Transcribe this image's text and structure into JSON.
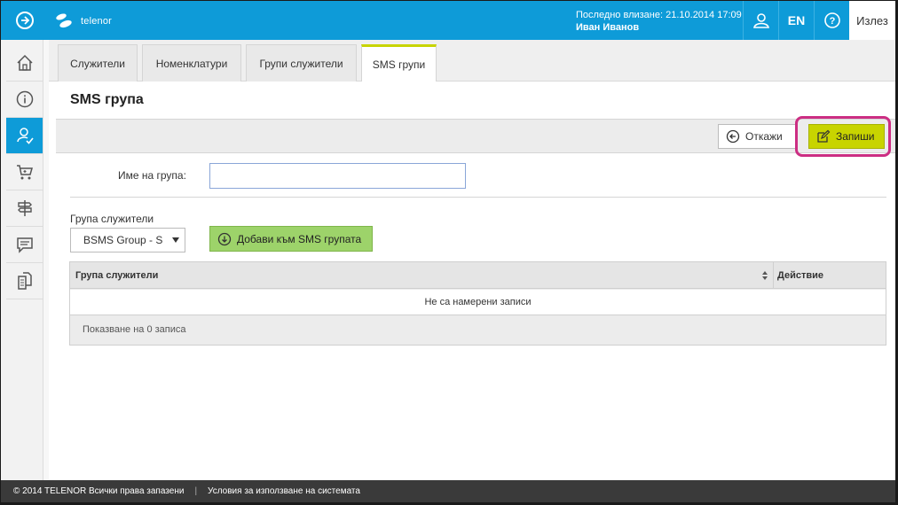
{
  "header": {
    "brand": "telenor",
    "last_login_label": "Последно влизане: 21.10.2014 17:09",
    "user_name": "Иван Иванов",
    "lang_label": "EN",
    "logout_label": "Излез"
  },
  "sidebar": {
    "items": [
      {
        "icon": "home-icon"
      },
      {
        "icon": "info-icon"
      },
      {
        "icon": "user-check-icon",
        "active": true
      },
      {
        "icon": "cart-icon"
      },
      {
        "icon": "signpost-icon"
      },
      {
        "icon": "chat-icon"
      },
      {
        "icon": "documents-icon"
      }
    ]
  },
  "tabs": [
    {
      "label": "Служители"
    },
    {
      "label": "Номенклатури"
    },
    {
      "label": "Групи служители"
    },
    {
      "label": "SMS групи",
      "active": true
    }
  ],
  "page": {
    "title": "SMS група",
    "cancel_label": "Откажи",
    "save_label": "Запиши",
    "group_name_label": "Име на група:",
    "group_name_value": "",
    "employee_group_label": "Група служители",
    "employee_group_selected": "BSMS Group - S",
    "add_button_label": "Добави към SMS групата"
  },
  "table": {
    "columns": [
      "Група служители",
      "Действие"
    ],
    "empty_message": "Не са намерени записи",
    "footer": "Показване на 0 записа"
  },
  "footer": {
    "copyright": "© 2014 TELENOR Всички права запазени",
    "terms": "Условия за използване на системата"
  },
  "colors": {
    "header_blue": "#0e9bd8",
    "accent_lime": "#c8d400",
    "add_green": "#9dd36a",
    "highlight_magenta": "#cc2e83"
  }
}
